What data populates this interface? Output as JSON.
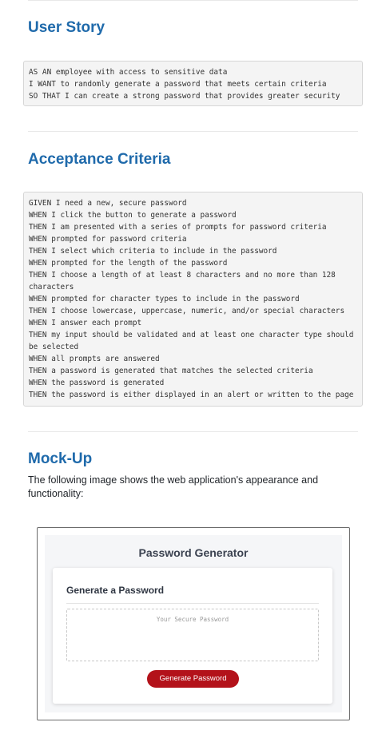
{
  "user_story": {
    "heading": "User Story",
    "code": "AS AN employee with access to sensitive data\nI WANT to randomly generate a password that meets certain criteria\nSO THAT I can create a strong password that provides greater security"
  },
  "acceptance_criteria": {
    "heading": "Acceptance Criteria",
    "code": "GIVEN I need a new, secure password\nWHEN I click the button to generate a password\nTHEN I am presented with a series of prompts for password criteria\nWHEN prompted for password criteria\nTHEN I select which criteria to include in the password\nWHEN prompted for the length of the password\nTHEN I choose a length of at least 8 characters and no more than 128 characters\nWHEN prompted for character types to include in the password\nTHEN I choose lowercase, uppercase, numeric, and/or special characters\nWHEN I answer each prompt\nTHEN my input should be validated and at least one character type should be selected\nWHEN all prompts are answered\nTHEN a password is generated that matches the selected criteria\nWHEN the password is generated\nTHEN the password is either displayed in an alert or written to the page"
  },
  "mock_up": {
    "heading": "Mock-Up",
    "intro": "The following image shows the web application's appearance and functionality:",
    "image": {
      "app_title": "Password Generator",
      "card_title": "Generate a Password",
      "password_placeholder": "Your Secure Password",
      "generate_button_label": "Generate Password",
      "button_color": "#b3121a"
    }
  },
  "colors": {
    "heading": "#1f6aab",
    "code_background": "#f4f4f4"
  }
}
